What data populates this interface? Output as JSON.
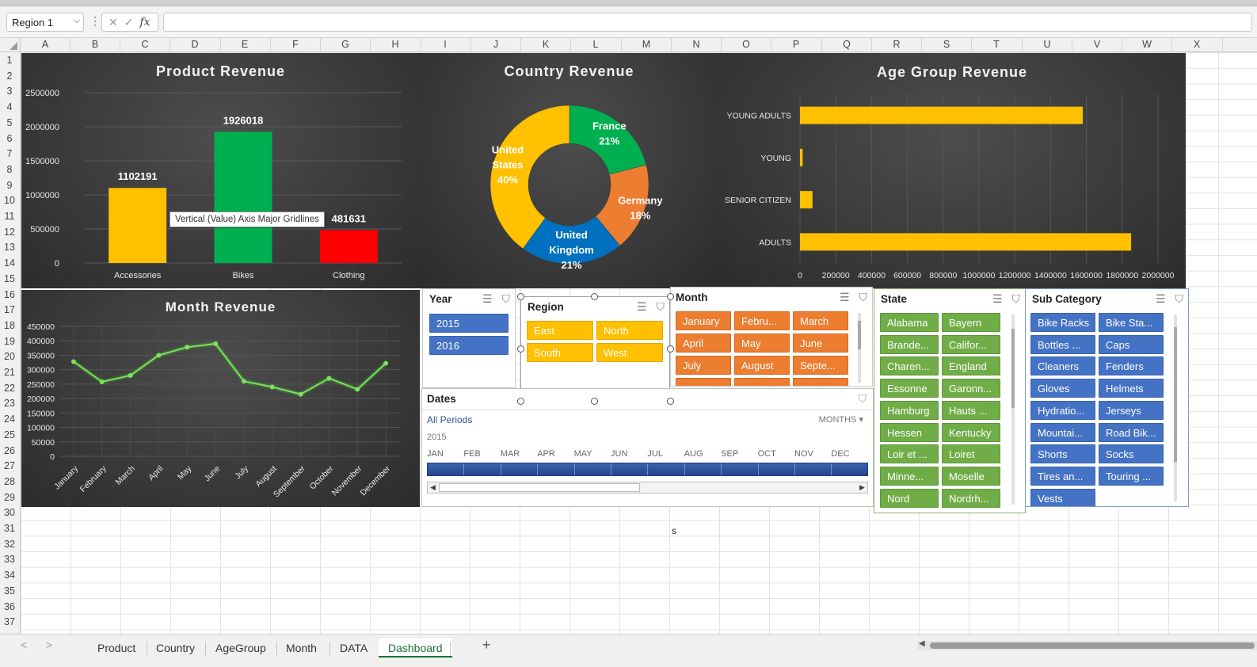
{
  "formula_bar": {
    "name_box": "Region 1",
    "fx": "fx",
    "cancel": "✕",
    "enter": "✓",
    "dots": "⋮"
  },
  "columns": [
    "A",
    "B",
    "C",
    "D",
    "E",
    "F",
    "G",
    "H",
    "I",
    "J",
    "K",
    "L",
    "M",
    "N",
    "O",
    "P",
    "Q",
    "R",
    "S",
    "T",
    "U",
    "V",
    "W",
    "X"
  ],
  "rows": [
    "1",
    "2",
    "3",
    "4",
    "5",
    "6",
    "7",
    "8",
    "9",
    "10",
    "11",
    "12",
    "13",
    "14",
    "15",
    "16",
    "17",
    "18",
    "19",
    "20",
    "21",
    "22",
    "23",
    "24",
    "25",
    "26",
    "27",
    "28",
    "29",
    "30",
    "31",
    "32",
    "33",
    "34",
    "35",
    "36",
    "37"
  ],
  "cell_text": "s",
  "tooltip": "Vertical (Value) Axis Major Gridlines",
  "charts": {
    "product": {
      "title": "Product Revenue",
      "y_ticks": [
        "2500000",
        "2000000",
        "1500000",
        "1000000",
        "500000",
        "0"
      ]
    },
    "country": {
      "title": "Country Revenue"
    },
    "age": {
      "title": "Age Group Revenue",
      "x_ticks": [
        "0",
        "200000",
        "400000",
        "600000",
        "800000",
        "1000000",
        "1200000",
        "1400000",
        "1600000",
        "1800000",
        "2000000"
      ]
    },
    "month": {
      "title": "Month Revenue",
      "y_ticks": [
        "450000",
        "400000",
        "350000",
        "300000",
        "250000",
        "200000",
        "150000",
        "100000",
        "50000",
        "0"
      ]
    }
  },
  "chart_data": [
    {
      "type": "bar",
      "title": "Product Revenue",
      "categories": [
        "Accessories",
        "Bikes",
        "Clothing"
      ],
      "values": [
        1102191,
        1926018,
        481631
      ],
      "colors": [
        "#ffc000",
        "#00b050",
        "#ff0000"
      ],
      "ylim": [
        0,
        2500000
      ],
      "grid": true
    },
    {
      "type": "pie",
      "title": "Country Revenue",
      "slices": [
        {
          "label": "France",
          "pct": "21%",
          "value": 21,
          "color": "#00b050"
        },
        {
          "label": "Germany",
          "pct": "18%",
          "value": 18,
          "color": "#ed7d31"
        },
        {
          "label": "United Kingdom",
          "pct": "21%",
          "value": 21,
          "color": "#0070c0"
        },
        {
          "label": "United States",
          "pct": "40%",
          "value": 40,
          "color": "#ffc000"
        }
      ]
    },
    {
      "type": "bar",
      "title": "Age Group Revenue",
      "orientation": "horizontal",
      "categories": [
        "YOUNG ADULTS",
        "YOUNG",
        "SENIOR CITIZEN",
        "ADULTS"
      ],
      "values": [
        1580000,
        15000,
        70000,
        1850000
      ],
      "xlim": [
        0,
        2000000
      ],
      "color": "#ffc000"
    },
    {
      "type": "line",
      "title": "Month Revenue",
      "categories": [
        "January",
        "February",
        "March",
        "April",
        "May",
        "June",
        "July",
        "August",
        "September",
        "October",
        "November",
        "December"
      ],
      "values": [
        328000,
        258000,
        280000,
        350000,
        378000,
        390000,
        260000,
        240000,
        215000,
        270000,
        232000,
        322000
      ],
      "ylim": [
        0,
        450000
      ],
      "color": "#7fe060"
    }
  ],
  "slicers": {
    "year": {
      "title": "Year",
      "items": [
        "2015",
        "2016"
      ]
    },
    "region": {
      "title": "Region",
      "items": [
        "East",
        "North",
        "South",
        "West"
      ]
    },
    "month": {
      "title": "Month",
      "items": [
        "January",
        "Febru...",
        "March",
        "April",
        "May",
        "June",
        "July",
        "August",
        "Septe..."
      ]
    },
    "state": {
      "title": "State",
      "items": [
        "Alabama",
        "Bayern",
        "Brande...",
        "Califor...",
        "Charen...",
        "England",
        "Essonne",
        "Garonn...",
        "Hamburg",
        "Hauts ...",
        "Hessen",
        "Kentucky",
        "Loir et ...",
        "Loiret",
        "Minne...",
        "Moselle",
        "Nord",
        "Nordrh..."
      ]
    },
    "subcategory": {
      "title": "Sub Category",
      "items": [
        "Bike Racks",
        "Bike Sta...",
        "Bottles ...",
        "Caps",
        "Cleaners",
        "Fenders",
        "Gloves",
        "Helmets",
        "Hydratio...",
        "Jerseys",
        "Mountai...",
        "Road Bik...",
        "Shorts",
        "Socks",
        "Tires an...",
        "Touring ...",
        "Vests"
      ]
    }
  },
  "timeline": {
    "title": "Dates",
    "period": "All Periods",
    "level": "MONTHS",
    "year": "2015",
    "months": [
      "JAN",
      "FEB",
      "MAR",
      "APR",
      "MAY",
      "JUN",
      "JUL",
      "AUG",
      "SEP",
      "OCT",
      "NOV",
      "DEC"
    ]
  },
  "sheets": {
    "tabs": [
      "Product",
      "Country",
      "AgeGroup",
      "Month",
      "DATA"
    ],
    "active": "Dashboard",
    "add": "+"
  }
}
